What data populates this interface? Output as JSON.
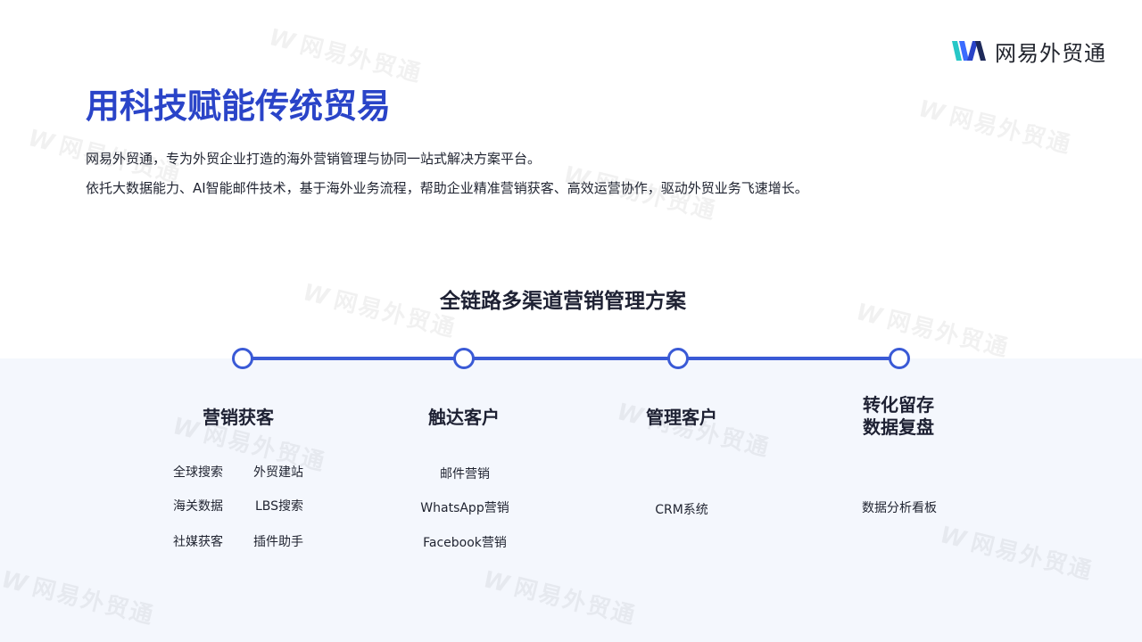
{
  "logo": {
    "text": "网易外贸通"
  },
  "title": "用科技赋能传统贸易",
  "intro": [
    "网易外贸通，专为外贸企业打造的海外营销管理与协同一站式解决方案平台。",
    "依托大数据能力、AI智能邮件技术，基于海外业务流程，帮助企业精准营销获客、高效运营协作，驱动外贸业务飞速增长。"
  ],
  "section_title": "全链路多渠道营销管理方案",
  "stages": [
    {
      "title": "营销获客",
      "items": [
        "全球搜索",
        "外贸建站",
        "海关数据",
        "LBS搜索",
        "社媒获客",
        "插件助手"
      ]
    },
    {
      "title": "触达客户",
      "items": [
        "邮件营销",
        "WhatsApp营销",
        "Facebook营销"
      ]
    },
    {
      "title": "管理客户",
      "items": [
        "CRM系统"
      ]
    },
    {
      "title_line1": "转化留存",
      "title_line2": "数据复盘",
      "items": [
        "数据分析看板"
      ]
    }
  ],
  "colors": {
    "accent": "#2a44c8",
    "timeline": "#3a5ad6",
    "band": "#f4f7fd"
  }
}
